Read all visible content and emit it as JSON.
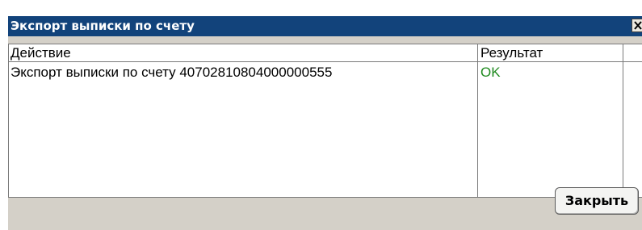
{
  "window": {
    "title": "Экспорт выписки по счету"
  },
  "table": {
    "columns": [
      "Действие",
      "Результат",
      ""
    ],
    "rows": [
      {
        "action": "Экспорт выписки по счету 40702810804000000555",
        "result": "OK"
      }
    ]
  },
  "footer": {
    "close_label": "Закрыть"
  },
  "colors": {
    "titlebar": "#12437b",
    "window_bg": "#d4d0c8",
    "ok_text": "#1f8a1f"
  },
  "icons": {
    "close": "close-icon"
  }
}
